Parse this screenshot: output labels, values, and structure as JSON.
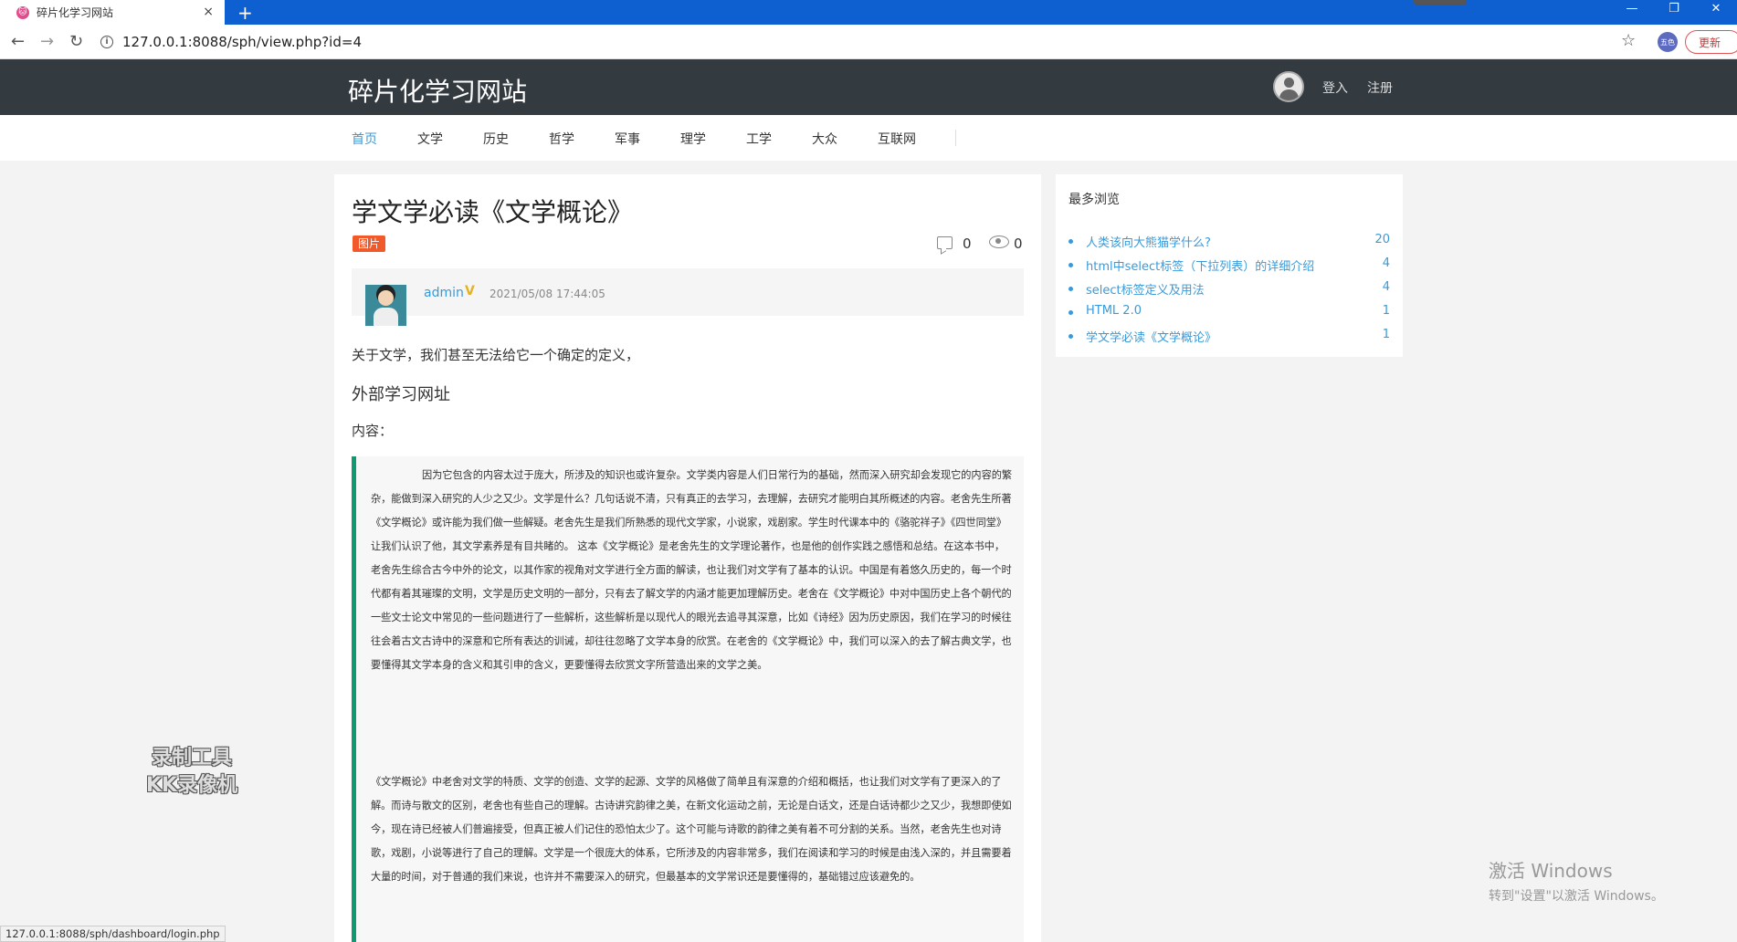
{
  "browser": {
    "tab_title": "碎片化学习网站",
    "tab_close": "×",
    "new_tab": "+",
    "favicon": "🐱",
    "url": "127.0.0.1:8088/sph/view.php?id=4",
    "profile_label": "五色",
    "update_label": "更新",
    "win_min": "—",
    "win_restore": "❐",
    "win_close": "✕",
    "back": "←",
    "forward": "→",
    "reload": "↻",
    "star": "☆",
    "info": "i"
  },
  "site": {
    "title": "碎片化学习网站",
    "login": "登入",
    "register": "注册"
  },
  "nav": {
    "items": [
      "首页",
      "文学",
      "历史",
      "哲学",
      "军事",
      "理学",
      "工学",
      "大众",
      "互联网"
    ]
  },
  "article": {
    "title": "学文学必读《文学概论》",
    "tag": "图片",
    "comment_count": "0",
    "view_count": "0",
    "author": "admin",
    "verified": "V",
    "time": "2021/05/08 17:44:05",
    "intro": "关于文学，我们甚至无法给它一个确定的定义，",
    "external_heading": "外部学习网址",
    "content_label": "内容：",
    "quote_p1": "因为它包含的内容太过于庞大，所涉及的知识也或许复杂。文学类内容是人们日常行为的基础，然而深入研究却会发现它的内容的繁杂，能做到深入研究的人少之又少。文学是什么？几句话说不清，只有真正的去学习，去理解，去研究才能明白其所概述的内容。老舍先生所著《文学概论》或许能为我们做一些解疑。老舍先生是我们所熟悉的现代文学家，小说家，戏剧家。学生时代课本中的《骆驼祥子》《四世同堂》让我们认识了他，其文学素养是有目共睹的。 这本《文学概论》是老舍先生的文学理论著作，也是他的创作实践之感悟和总结。在这本书中，老舍先生综合古今中外的论文，以其作家的视角对文学进行全方面的解读，也让我们对文学有了基本的认识。中国是有着悠久历史的，每一个时代都有着其璀璨的文明，文学是历史文明的一部分，只有去了解文学的内涵才能更加理解历史。老舍在《文学概论》中对中国历史上各个朝代的一些文士论文中常见的一些问题进行了一些解析，这些解析是以现代人的眼光去追寻其深意，比如《诗经》因为历史原因，我们在学习的时候往往会着古文古诗中的深意和它所有表达的训诫，却往往忽略了文学本身的欣赏。在老舍的《文学概论》中，我们可以深入的去了解古典文学，也要懂得其文学本身的含义和其引申的含义，更要懂得去欣赏文字所营造出来的文学之美。",
    "quote_p2": "《文学概论》中老舍对文学的特质、文学的创造、文学的起源、文学的风格做了简单且有深意的介绍和概括，也让我们对文学有了更深入的了解。而诗与散文的区别，老舍也有些自己的理解。古诗讲究韵律之美，在新文化运动之前，无论是白话文，还是白话诗都少之又少，我想即使如今，现在诗已经被人们普遍接受，但真正被人们记住的恐怕太少了。这个可能与诗歌的韵律之美有着不可分割的关系。当然，老舍先生也对诗歌，戏剧，小说等进行了自己的理解。文学是一个很庞大的体系，它所涉及的内容非常多，我们在阅读和学习的时候是由浅入深的，并且需要着大量的时间，对于普通的我们来说，也许并不需要深入的研究，但最基本的文学常识还是要懂得的，基础错过应该避免的。"
  },
  "sidebar": {
    "title": "最多浏览",
    "items": [
      {
        "title": "人类该向大熊猫学什么?",
        "count": "20"
      },
      {
        "title": "html中select标签（下拉列表）的详细介绍",
        "count": "4"
      },
      {
        "title": "select标签定义及用法",
        "count": "4"
      },
      {
        "title": "HTML 2.0",
        "count": "1"
      },
      {
        "title": "学文学必读《文学概论》",
        "count": "1"
      }
    ]
  },
  "overlay": {
    "status_url": "127.0.0.1:8088/sph/dashboard/login.php",
    "watermark_line1": "录制工具",
    "watermark_line2": "KK录像机",
    "activate_line1": "激活 Windows",
    "activate_line2": "转到\"设置\"以激活 Windows。"
  }
}
